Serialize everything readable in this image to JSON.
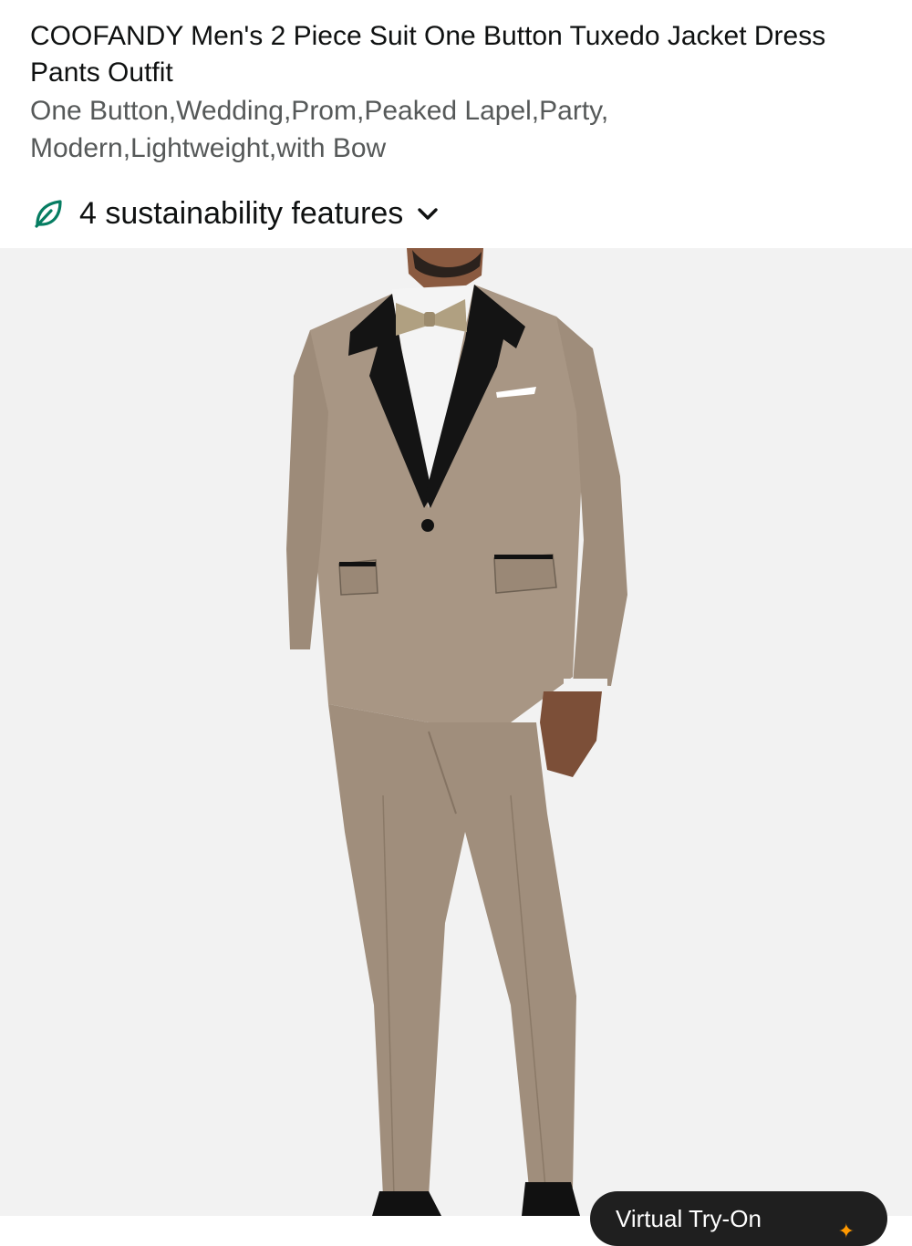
{
  "product": {
    "title": "COOFANDY Men's 2 Piece Suit One Button Tuxedo Jacket Dress Pants Outfit",
    "subtitle": "One Button,Wedding,Prom,Peaked Lapel,Party, Modern,Lightweight,with Bow"
  },
  "sustainability": {
    "label": "4 sustainability features",
    "icon": "leaf-icon",
    "expand_icon": "chevron-down-icon",
    "accent_color": "#067d62"
  },
  "image": {
    "alt": "Man wearing a taupe two-piece tuxedo suit with black peaked lapels and a taupe bow tie",
    "suit_color": "#a89684",
    "lapel_color": "#141414"
  },
  "virtual_try_on": {
    "label": "Virtual Try-On"
  }
}
